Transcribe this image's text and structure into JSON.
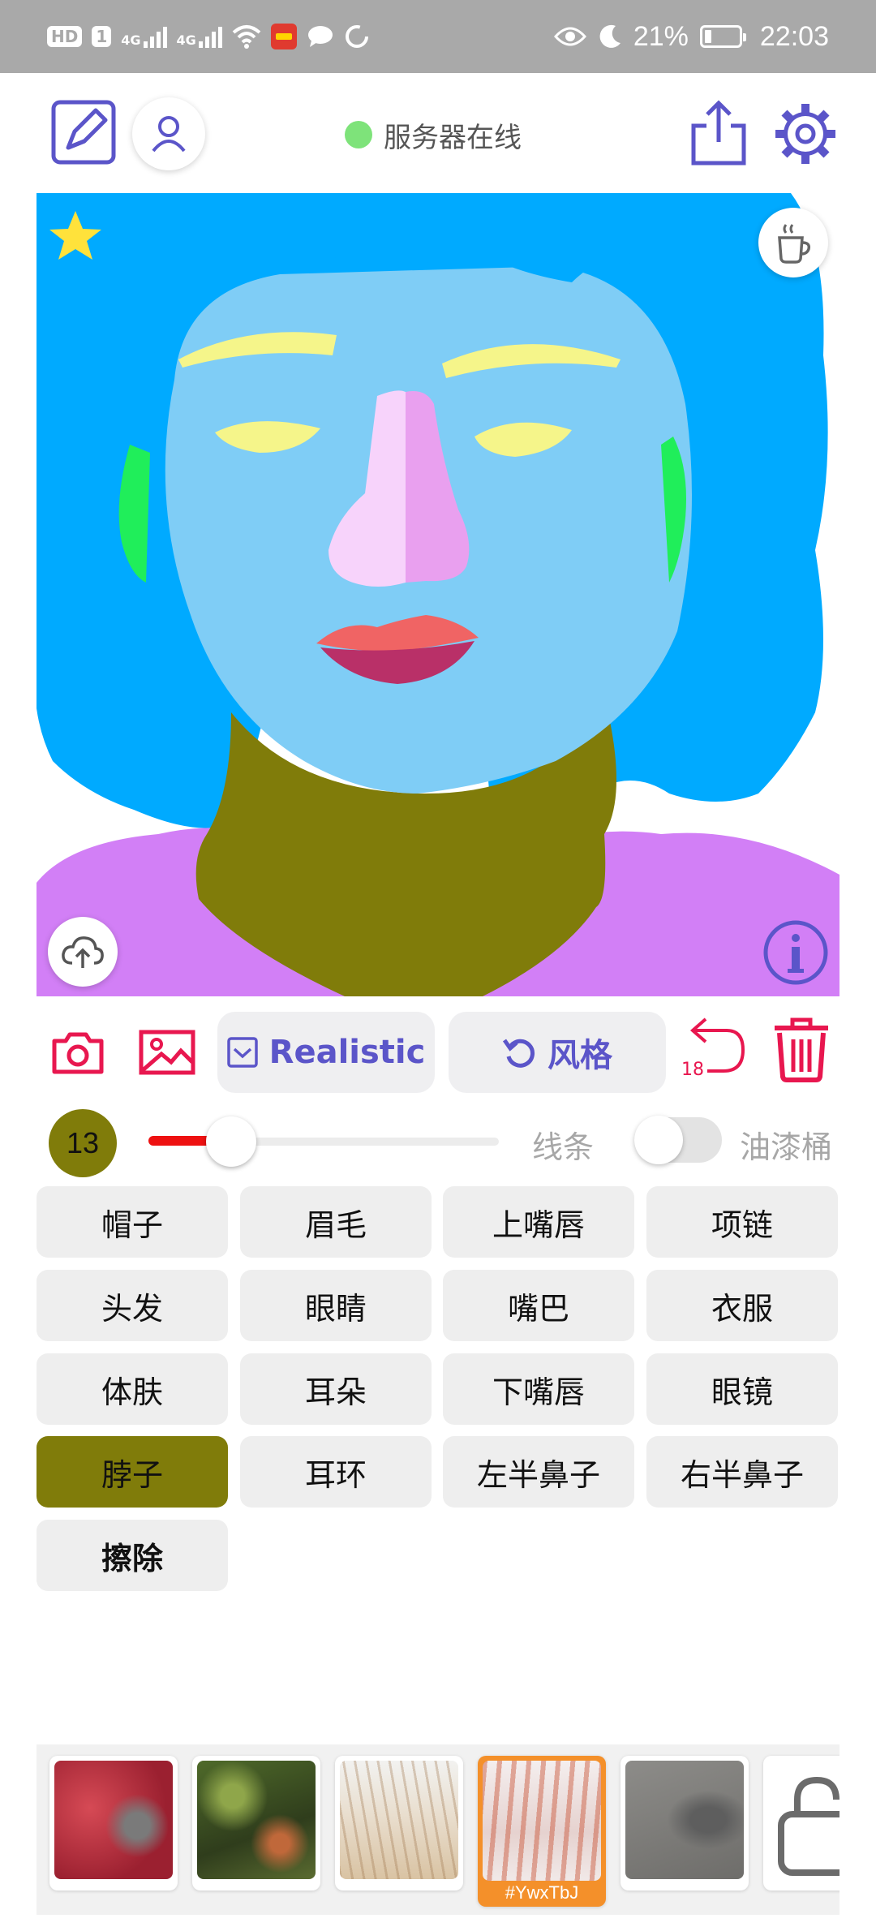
{
  "status_bar": {
    "hd_label": "HD",
    "sim_label": "1",
    "network1": "4G",
    "network2": "4G",
    "battery_percent": "21%",
    "time": "22:03"
  },
  "header": {
    "server_status": "服务器在线",
    "server_status_color": "#7ee37a"
  },
  "toolbar": {
    "mode_label": "Realistic",
    "style_label": "风格",
    "undo_count": "18"
  },
  "brush": {
    "size": "13",
    "size_color": "#807c0a",
    "slider_fraction": 0.23,
    "line_label": "线条",
    "bucket_label": "油漆桶",
    "bucket_enabled": false
  },
  "categories": [
    {
      "label": "帽子"
    },
    {
      "label": "眉毛"
    },
    {
      "label": "上嘴唇"
    },
    {
      "label": "项链"
    },
    {
      "label": "头发"
    },
    {
      "label": "眼睛"
    },
    {
      "label": "嘴巴"
    },
    {
      "label": "衣服"
    },
    {
      "label": "体肤"
    },
    {
      "label": "耳朵"
    },
    {
      "label": "下嘴唇"
    },
    {
      "label": "眼镜"
    },
    {
      "label": "脖子",
      "selected": true,
      "color": "#807c0a"
    },
    {
      "label": "耳环"
    },
    {
      "label": "左半鼻子"
    },
    {
      "label": "右半鼻子"
    },
    {
      "label": "擦除"
    }
  ],
  "gallery": {
    "selected_tag": "#YwxTbJ"
  },
  "colors": {
    "accent_purple": "#5b55c9",
    "accent_red": "#e8174f",
    "hair": "#00aaff",
    "skin": "#7fcdf6",
    "neck": "#807c0a",
    "clothes": "#d27ff6"
  }
}
